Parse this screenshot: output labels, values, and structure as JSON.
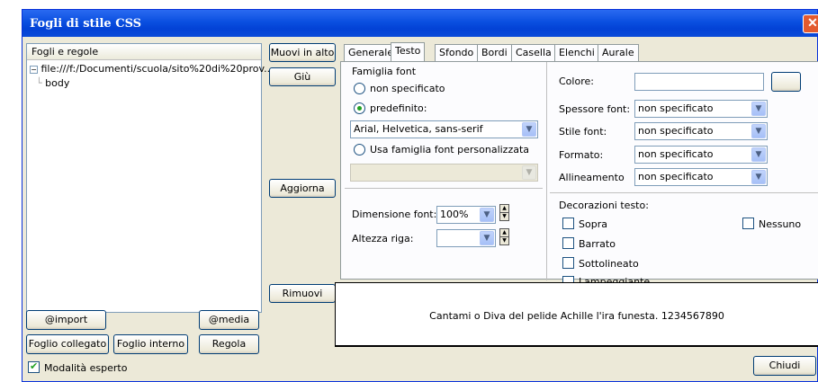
{
  "window": {
    "title": "Fogli di stile CSS",
    "close_symbol": "✕"
  },
  "tree": {
    "header": "Fogli e regole",
    "file_label": "file:///f:/Documenti/scuola/sito%20di%20prov...",
    "rule_label": "body"
  },
  "left_buttons": {
    "import": "@import",
    "media": "@media",
    "linked": "Foglio collegato",
    "internal": "Foglio interno",
    "rule": "Regola"
  },
  "expert_mode": {
    "label": "Modalità esperto",
    "checked": true
  },
  "middle_buttons": {
    "move_up": "Muovi in alto",
    "move_down": "Giù",
    "refresh": "Aggiorna",
    "remove": "Rimuovi"
  },
  "tabs": [
    "Generale",
    "Testo",
    "Sfondo",
    "Bordi",
    "Casella",
    "Elenchi",
    "Aurale"
  ],
  "active_tab": "Testo",
  "font_family": {
    "group_label": "Famiglia font",
    "option_unspecified": "non specificato",
    "option_predefined": "predefinito:",
    "predefined_value": "Arial, Helvetica, sans-serif",
    "option_custom": "Usa famiglia font personalizzata",
    "custom_value": ""
  },
  "font_size": {
    "label": "Dimensione font:",
    "value": "100%"
  },
  "line_height": {
    "label": "Altezza riga:",
    "value": ""
  },
  "color": {
    "label": "Colore:",
    "value": ""
  },
  "font_weight": {
    "label": "Spessore font:",
    "value": "non specificato"
  },
  "font_style": {
    "label": "Stile font:",
    "value": "non specificato"
  },
  "format": {
    "label": "Formato:",
    "value": "non specificato"
  },
  "alignment": {
    "label": "Allineamento",
    "value": "non specificato"
  },
  "decorations": {
    "label": "Decorazioni testo:",
    "overline": "Sopra",
    "strikethrough": "Barrato",
    "underline": "Sottolineato",
    "blink": "Lampeggiante",
    "none": "Nessuno"
  },
  "preview_text": "Cantami o Diva del pelide Achille l'ira funesta. 1234567890",
  "close_button": "Chiudi"
}
